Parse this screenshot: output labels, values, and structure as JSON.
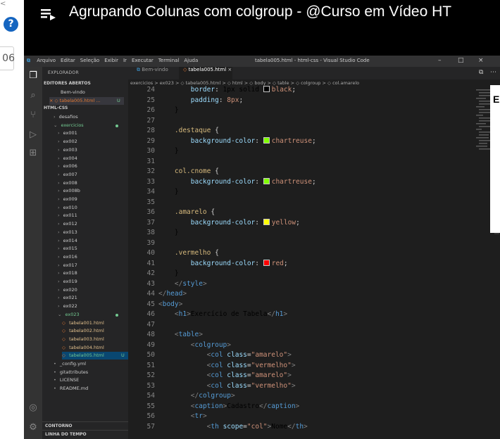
{
  "page": {
    "help_badge": "?",
    "partial_field_value": "06",
    "corner_mark": "<"
  },
  "video": {
    "title": "Agrupando Colunas com colgroup - @Curso em Vídeo HT"
  },
  "vscode": {
    "menu": [
      "Arquivo",
      "Editar",
      "Seleção",
      "Exibir",
      "Ir",
      "Executar",
      "Terminal",
      "Ajuda"
    ],
    "window_title": "tabela005.html - html-css - Visual Studio Code",
    "window_controls": [
      "–",
      "□",
      "×"
    ],
    "sidebar": {
      "header": "EXPLORADOR",
      "open_editors_title": "EDITORES ABERTOS",
      "open_editors": [
        {
          "label": "Bem-vindo"
        },
        {
          "label": "× ◇ tabela005.html ...",
          "badge": "U"
        }
      ],
      "workspace_title": "HTML-CSS",
      "tree": [
        {
          "label": "desafios",
          "kind": "folder"
        },
        {
          "label": "exercicios",
          "kind": "folder-open"
        },
        {
          "label": "ex001",
          "kind": "folder"
        },
        {
          "label": "ex002",
          "kind": "folder"
        },
        {
          "label": "ex003",
          "kind": "folder"
        },
        {
          "label": "ex004",
          "kind": "folder"
        },
        {
          "label": "ex006",
          "kind": "folder"
        },
        {
          "label": "ex007",
          "kind": "folder"
        },
        {
          "label": "ex008",
          "kind": "folder"
        },
        {
          "label": "ex008b",
          "kind": "folder"
        },
        {
          "label": "ex009",
          "kind": "folder"
        },
        {
          "label": "ex010",
          "kind": "folder"
        },
        {
          "label": "ex011",
          "kind": "folder"
        },
        {
          "label": "ex012",
          "kind": "folder"
        },
        {
          "label": "ex013",
          "kind": "folder"
        },
        {
          "label": "ex014",
          "kind": "folder"
        },
        {
          "label": "ex015",
          "kind": "folder"
        },
        {
          "label": "ex016",
          "kind": "folder"
        },
        {
          "label": "ex017",
          "kind": "folder"
        },
        {
          "label": "ex018",
          "kind": "folder"
        },
        {
          "label": "ex019",
          "kind": "folder"
        },
        {
          "label": "ex020",
          "kind": "folder"
        },
        {
          "label": "ex021",
          "kind": "folder"
        },
        {
          "label": "ex022",
          "kind": "folder"
        },
        {
          "label": "ex023",
          "kind": "folder-open"
        },
        {
          "label": "tabela001.html",
          "kind": "file"
        },
        {
          "label": "tabela002.html",
          "kind": "file"
        },
        {
          "label": "tabela003.html",
          "kind": "file"
        },
        {
          "label": "tabela004.html",
          "kind": "file"
        },
        {
          "label": "tabela005.html",
          "kind": "file",
          "badge": "U"
        },
        {
          "label": "_config.yml",
          "kind": "root-file"
        },
        {
          "label": "gitattributes",
          "kind": "root-file"
        },
        {
          "label": "LICENSE",
          "kind": "root-file"
        },
        {
          "label": "README.md",
          "kind": "root-file"
        }
      ],
      "bottom_sections": [
        "CONTORNO",
        "LINHA DO TEMPO"
      ]
    },
    "tabs": [
      {
        "label": "Bem-vindo",
        "active": false
      },
      {
        "label": "tabela005.html",
        "active": true
      }
    ],
    "breadcrumb": "exercicios > ex023 > ◇ tabela005.html > ◇ html > ◇ body > ◇ table > ◇ colgroup > ◇ col.amarelo",
    "code_lines": [
      {
        "n": "24",
        "text": "        border: 1px solid □black;"
      },
      {
        "n": "25",
        "text": "        padding: 8px;"
      },
      {
        "n": "26",
        "text": "    }"
      },
      {
        "n": "27",
        "text": ""
      },
      {
        "n": "28",
        "text": "    .destaque {"
      },
      {
        "n": "29",
        "text": "        background-color: ■chartreuse;"
      },
      {
        "n": "30",
        "text": "    }"
      },
      {
        "n": "31",
        "text": ""
      },
      {
        "n": "32",
        "text": "    col.cnome {"
      },
      {
        "n": "33",
        "text": "        background-color: ■chartreuse;"
      },
      {
        "n": "34",
        "text": "    }"
      },
      {
        "n": "35",
        "text": ""
      },
      {
        "n": "36",
        "text": "    .amarelo {"
      },
      {
        "n": "37",
        "text": "        background-color: ■yellow;"
      },
      {
        "n": "38",
        "text": "    }"
      },
      {
        "n": "39",
        "text": ""
      },
      {
        "n": "40",
        "text": "    .vermelho {"
      },
      {
        "n": "41",
        "text": "        background-color: ■red;"
      },
      {
        "n": "42",
        "text": "    }"
      },
      {
        "n": "43",
        "text": "    </style>"
      },
      {
        "n": "44",
        "text": "</head>"
      },
      {
        "n": "45",
        "text": "<body>"
      },
      {
        "n": "46",
        "text": "    <h1>Exercício de Tabela</h1>"
      },
      {
        "n": "47",
        "text": ""
      },
      {
        "n": "48",
        "text": "    <table>"
      },
      {
        "n": "49",
        "text": "        <colgroup>"
      },
      {
        "n": "50",
        "text": "            <col class=\"amarelo\">"
      },
      {
        "n": "51",
        "text": "            <col class=\"vermelho\">"
      },
      {
        "n": "52",
        "text": "            <col class=\"amarelo\">"
      },
      {
        "n": "53",
        "text": "            <col class=\"vermelho\">"
      },
      {
        "n": "54",
        "text": "        </colgroup>"
      },
      {
        "n": "55",
        "text": "        <caption>Cadastro</caption>"
      },
      {
        "n": "56",
        "text": "        <tr>"
      },
      {
        "n": "57",
        "text": "            <th scope=\"col\">Nome</th>"
      }
    ],
    "colors": {
      "chartreuse": "#7fff00",
      "yellow": "#ffff00",
      "red": "#ff0000",
      "black": "#000000"
    }
  }
}
